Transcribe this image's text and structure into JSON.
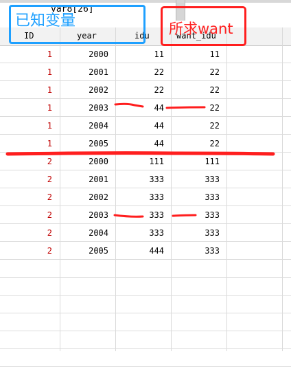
{
  "cell_reference": "var8[26]",
  "annotations": {
    "known_vars_label": "已知变量",
    "wanted_label": "所求want",
    "blue_color": "#1ea0ff",
    "red_color": "#ff1e1e"
  },
  "columns": [
    "ID",
    "year",
    "idu",
    "want_idu"
  ],
  "rows": [
    {
      "id": "1",
      "year": "2000",
      "idu": "11",
      "want": "11"
    },
    {
      "id": "1",
      "year": "2001",
      "idu": "22",
      "want": "22"
    },
    {
      "id": "1",
      "year": "2002",
      "idu": "22",
      "want": "22"
    },
    {
      "id": "1",
      "year": "2003",
      "idu": "44",
      "want": "22"
    },
    {
      "id": "1",
      "year": "2004",
      "idu": "44",
      "want": "22"
    },
    {
      "id": "1",
      "year": "2005",
      "idu": "44",
      "want": "22"
    },
    {
      "id": "2",
      "year": "2000",
      "idu": "111",
      "want": "111"
    },
    {
      "id": "2",
      "year": "2001",
      "idu": "333",
      "want": "333"
    },
    {
      "id": "2",
      "year": "2002",
      "idu": "333",
      "want": "333"
    },
    {
      "id": "2",
      "year": "2003",
      "idu": "333",
      "want": "333"
    },
    {
      "id": "2",
      "year": "2004",
      "idu": "333",
      "want": "333"
    },
    {
      "id": "2",
      "year": "2005",
      "idu": "444",
      "want": "333"
    }
  ]
}
